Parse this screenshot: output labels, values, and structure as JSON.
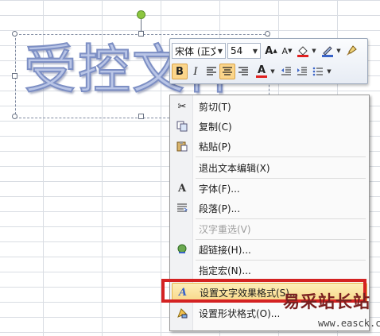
{
  "wordart": {
    "text": "受控文件"
  },
  "mini_toolbar": {
    "font_name": "宋体 (正文",
    "font_size": "54",
    "grow_font": "A",
    "shrink_font": "A",
    "bold": "B",
    "italic": "I",
    "font_color": "A"
  },
  "context_menu": {
    "items": [
      {
        "label": "剪切(T)",
        "icon": "scissors-icon"
      },
      {
        "label": "复制(C)",
        "icon": "copy-icon"
      },
      {
        "label": "粘贴(P)",
        "icon": "paste-icon"
      },
      {
        "label": "退出文本编辑(X)",
        "icon": ""
      },
      {
        "label": "字体(F)...",
        "icon": "font-icon"
      },
      {
        "label": "段落(P)...",
        "icon": "paragraph-icon"
      },
      {
        "label": "汉字重选(V)",
        "icon": "",
        "disabled": true
      },
      {
        "label": "超链接(H)...",
        "icon": "hyperlink-icon"
      },
      {
        "label": "指定宏(N)...",
        "icon": ""
      },
      {
        "label": "设置文字效果格式(S)...",
        "icon": "text-effects-icon"
      },
      {
        "label": "设置形状格式(O)...",
        "icon": "shape-format-icon"
      }
    ]
  },
  "watermark": {
    "site_name": "易采站长站",
    "url": "www.easck.com"
  },
  "colors": {
    "highlight": "#f8d98a",
    "callout_red": "#d42222",
    "rotation_handle": "#8cc63f"
  }
}
